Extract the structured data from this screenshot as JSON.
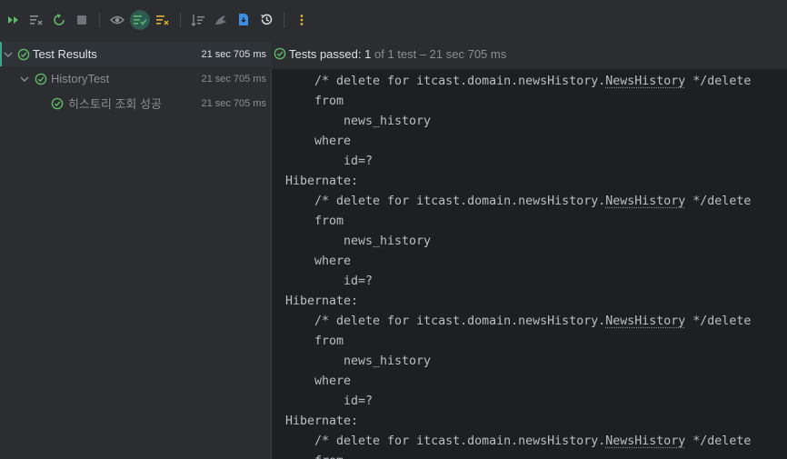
{
  "toolbar": {
    "buttons": [
      {
        "icon": "rerun-failed-icon"
      },
      {
        "icon": "rerun-list-icon"
      },
      {
        "icon": "toggle-auto-test-icon"
      },
      {
        "icon": "stop-icon"
      },
      {
        "icon": "show-passed-icon"
      },
      {
        "icon": "show-ignored-icon"
      },
      {
        "icon": "clear-icon"
      },
      {
        "icon": "sort-icon"
      },
      {
        "icon": "import-tests-icon"
      },
      {
        "icon": "export-icon"
      },
      {
        "icon": "history-icon"
      },
      {
        "icon": "more-icon"
      }
    ]
  },
  "tree": {
    "root": {
      "label": "Test Results",
      "duration": "21 sec 705 ms"
    },
    "class": {
      "label": "HistoryTest",
      "duration": "21 sec 705 ms"
    },
    "test": {
      "label": "히스토리 조회 성공",
      "duration": "21 sec 705 ms"
    }
  },
  "status": {
    "label": "Tests passed:",
    "passed": "1",
    "rest": "of 1 test – 21 sec 705 ms"
  },
  "console": {
    "hibernate": "Hibernate:",
    "comment_prefix": "/* delete for itcast.domain.newsHistory.",
    "entity": "NewsHistory",
    "comment_suffix": " */delete",
    "from": "from",
    "table": "news_history",
    "where": "where",
    "cond": "id=?"
  },
  "colors": {
    "accent_green": "#5fb865",
    "selection_bar": "#3fa28b",
    "text": "#bcbec4",
    "muted": "#8c8f94"
  }
}
